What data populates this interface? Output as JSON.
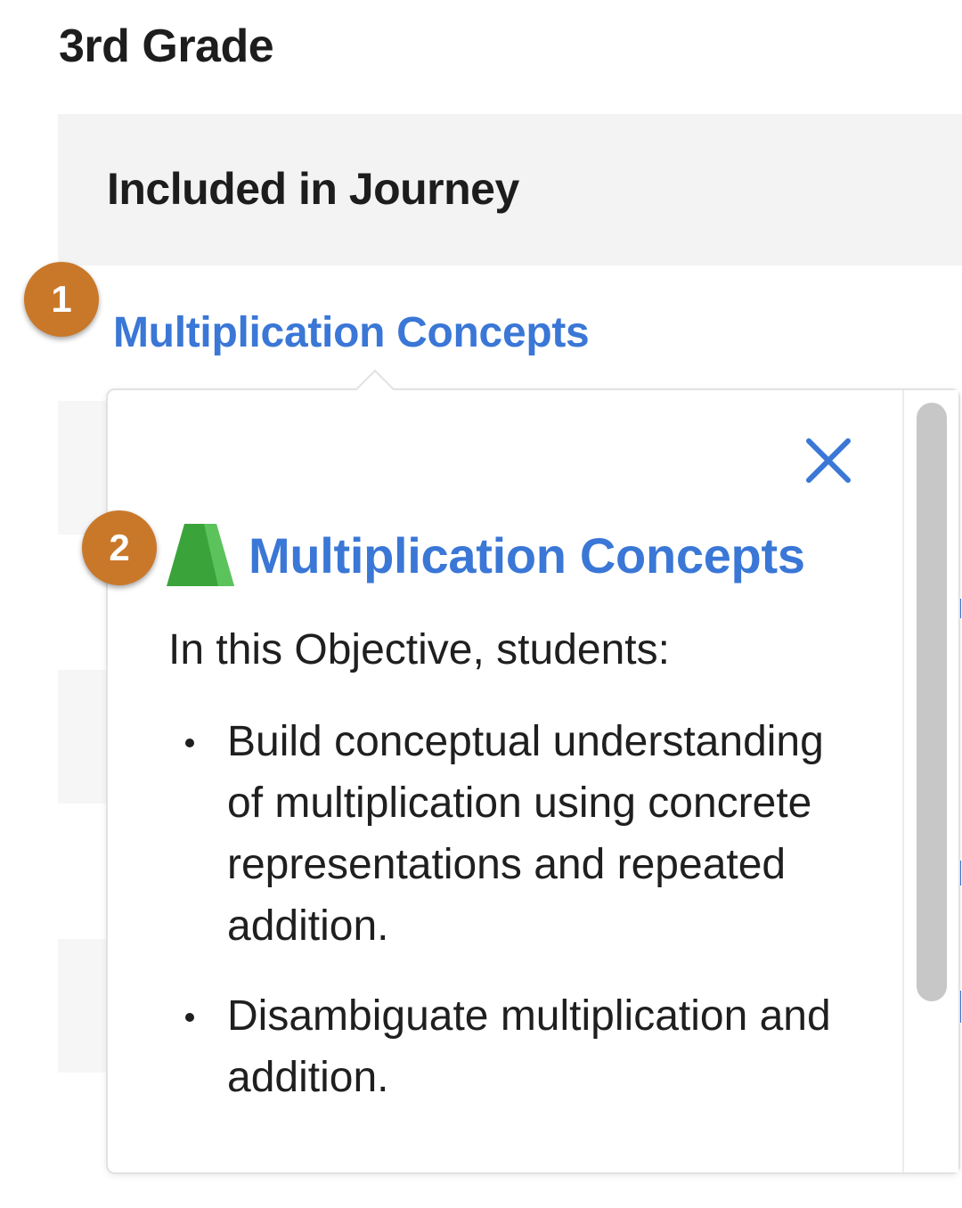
{
  "page": {
    "grade_title": "3rd Grade",
    "section_header": "Included in Journey"
  },
  "objective": {
    "link_label": "Multiplication Concepts",
    "badge_number": "1"
  },
  "popover": {
    "badge_number": "2",
    "close_icon": "close-icon",
    "level_icon": "green-trapezoid-icon",
    "title": "Multiplication Concepts",
    "intro": "In this Objective, students:",
    "bullets": [
      "Build conceptual understanding of multiplication using concrete representations and repeated addition.",
      "Disambiguate multiplication and addition."
    ]
  },
  "colors": {
    "link_blue": "#3a77d6",
    "badge_orange": "#c9782a",
    "level_green": "#3aa43a",
    "band_gray": "#f3f3f3"
  }
}
